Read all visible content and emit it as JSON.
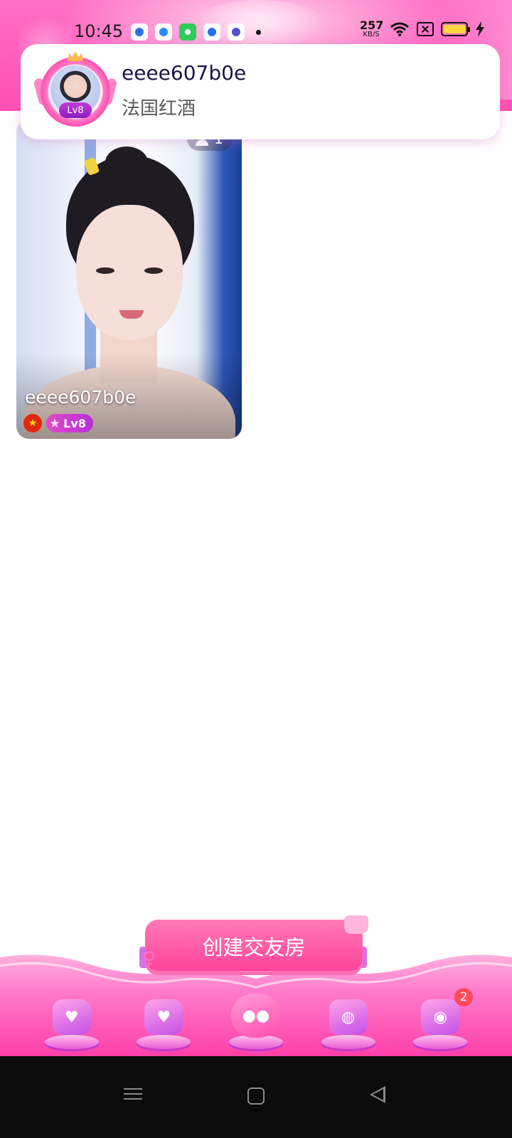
{
  "status_bar": {
    "time": "10:45",
    "net_speed_value": "257",
    "net_speed_unit": "KB/S",
    "app_icons": [
      "baidu-icon",
      "browser-icon",
      "store-icon",
      "qq-browser-icon",
      "planet-app-icon"
    ],
    "battery_color": "#ffd640"
  },
  "notification": {
    "name": "eeee607b0e",
    "message": "法国红酒",
    "level": "Lv8"
  },
  "room_card": {
    "viewer_count": "1",
    "host_name": "eeee607b0e",
    "flag": "china-flag-icon",
    "level": "Lv8"
  },
  "create_room": {
    "label": "创建交友房"
  },
  "bottom_nav": {
    "items": [
      {
        "icon": "video-heart-icon"
      },
      {
        "icon": "tv-heart-icon"
      },
      {
        "icon": "chat-room-icon"
      },
      {
        "icon": "planet-icon"
      },
      {
        "icon": "message-icon",
        "badge": "2"
      }
    ]
  },
  "theme": {
    "accent": "#ff4fb3",
    "purple": "#c54ee8"
  }
}
